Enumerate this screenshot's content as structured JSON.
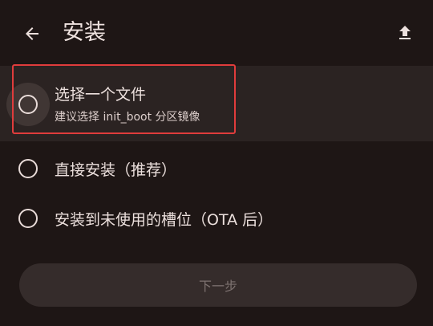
{
  "header": {
    "title": "安装",
    "back_icon": "arrow-left-icon",
    "upload_icon": "upload-icon"
  },
  "options": [
    {
      "label": "选择一个文件",
      "subtitle": "建议选择 init_boot 分区镜像",
      "selected": false
    },
    {
      "label": "直接安装（推荐）",
      "selected": false
    },
    {
      "label": "安装到未使用的槽位（OTA 后）",
      "selected": false
    }
  ],
  "next_button": {
    "label": "下一步",
    "enabled": false
  },
  "colors": {
    "background": "#1e1615",
    "highlight_border": "#e03c3c"
  }
}
